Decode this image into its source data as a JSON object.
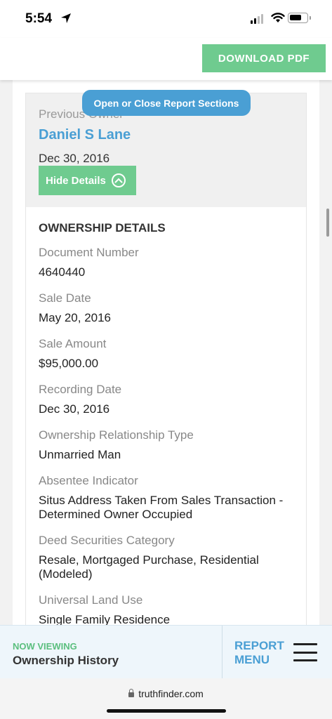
{
  "status_bar": {
    "time": "5:54"
  },
  "header": {
    "download_label": "DOWNLOAD PDF"
  },
  "tooltip": {
    "label": "Open or Close Report Sections"
  },
  "owner": {
    "label": "Previous Owner",
    "name": "Daniel S Lane",
    "date": "Dec 30, 2016",
    "hide_label": "Hide Details"
  },
  "details": {
    "title": "OWNERSHIP DETAILS",
    "fields": [
      {
        "label": "Document Number",
        "value": "4640440"
      },
      {
        "label": "Sale Date",
        "value": "May 20, 2016"
      },
      {
        "label": "Sale Amount",
        "value": "$95,000.00"
      },
      {
        "label": "Recording Date",
        "value": "Dec 30, 2016"
      },
      {
        "label": "Ownership Relationship Type",
        "value": "Unmarried Man"
      },
      {
        "label": "Absentee Indicator",
        "value": "Situs Address Taken From Sales Transaction - Determined Owner Occupied"
      },
      {
        "label": "Deed Securities Category",
        "value": "Resale, Mortgaged Purchase, Residential (Modeled)"
      },
      {
        "label": "Universal Land Use",
        "value": "Single Family Residence"
      }
    ]
  },
  "bottom_bar": {
    "now_viewing_label": "NOW VIEWING",
    "section": "Ownership History",
    "report_menu_line1": "REPORT",
    "report_menu_line2": "MENU"
  },
  "browser": {
    "url": "truthfinder.com"
  },
  "colors": {
    "green": "#6fcb8f",
    "blue": "#4a9fd4"
  }
}
